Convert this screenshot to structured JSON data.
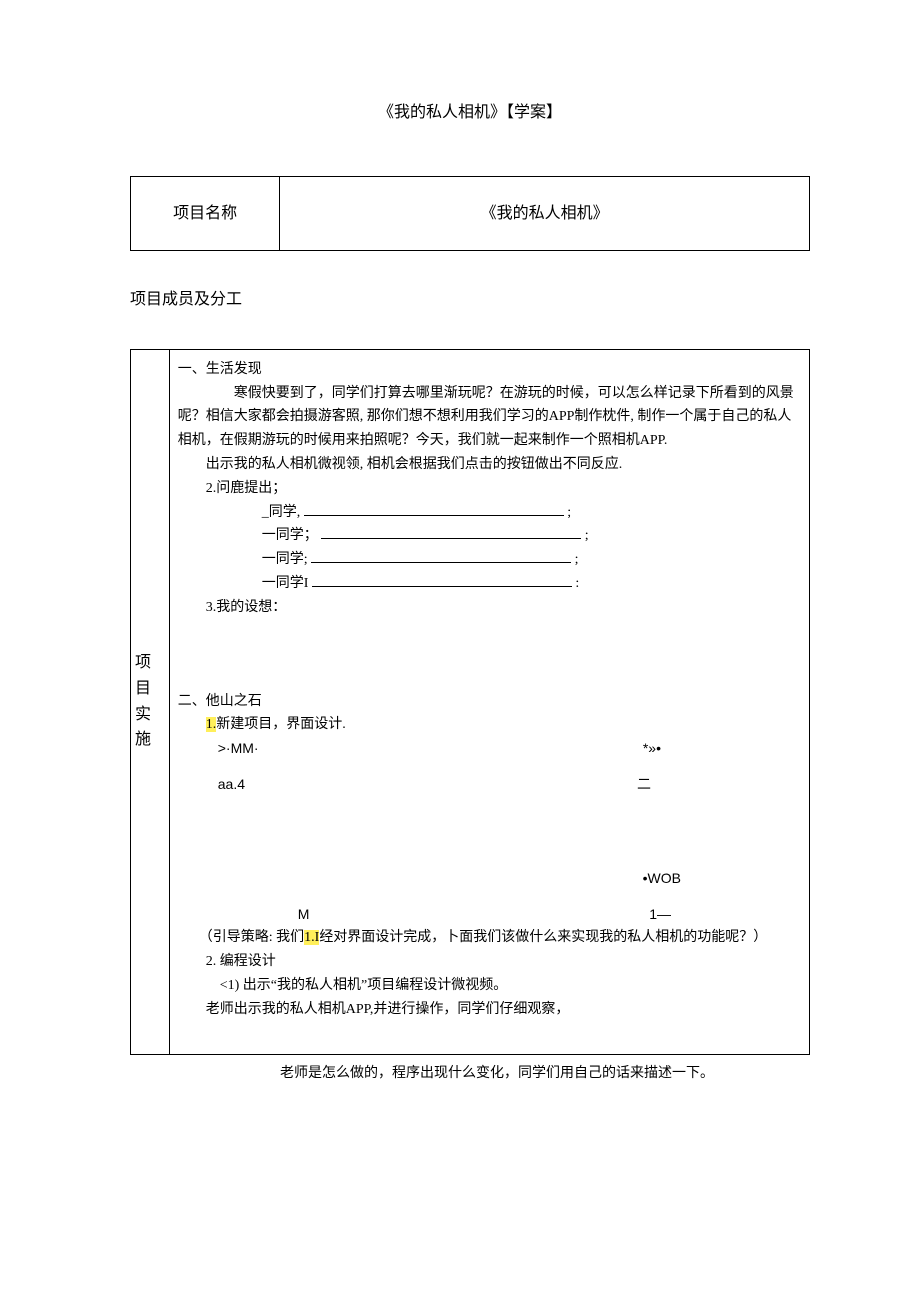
{
  "title": "《我的私人相机》【学案】",
  "table1": {
    "label": "项目名称",
    "value": "《我的私人相机》"
  },
  "members_heading": "项目成员及分工",
  "impl_label": "项目实施",
  "section1": {
    "heading": "一、生活发现",
    "p1": "寒假快要到了，同学们打算去哪里渐玩呢？在游玩的时候，可以怎么样记录下所看到的风景呢？相信大家都会拍摄游客照, 那你们想不想利用我们学习的APP制作枕件, 制作一个属于自己的私人相机，在假期游玩的时候用来拍照呢？今天，我们就一起来制作一个照相机APP.",
    "p2": "出示我的私人相机微视领, 相机会根据我们点击的按钮做出不同反应.",
    "q_heading": "2.问鹿提出；",
    "student_prefixes": [
      "_同学,",
      "一同学；",
      "一同学;",
      "一同学I"
    ],
    "student_tails": [
      ";",
      ";",
      ";",
      ":"
    ],
    "p3": "3.我的设想："
  },
  "section2": {
    "heading": "二、他山之石",
    "s1_num": "1.",
    "s1_text": "新建项目，界面设计.",
    "frag1_l": ">·MM·",
    "frag1_r": "*»•",
    "frag2_l": "aa.4",
    "frag2_r": "二",
    "frag3_r": "•WOB",
    "frag4_l": "M",
    "frag4_r": "1—",
    "guide_pre": "（引导策略: 我们",
    "guide_hl": "1.I",
    "guide_post": "经对界面设计完成，卜面我们该做什么来实现我的私人相机的功能呢？）",
    "s2": "2. 编程设计",
    "s2_1": "<1) 出示“我的私人相机”项目编程设计微视频。",
    "s2_2": "老师出示我的私人相机APP,并进行操作，同学们仔细观察，"
  },
  "trailing": "老师是怎么做的，程序出现什么变化，同学们用自己的话来描述一下。"
}
